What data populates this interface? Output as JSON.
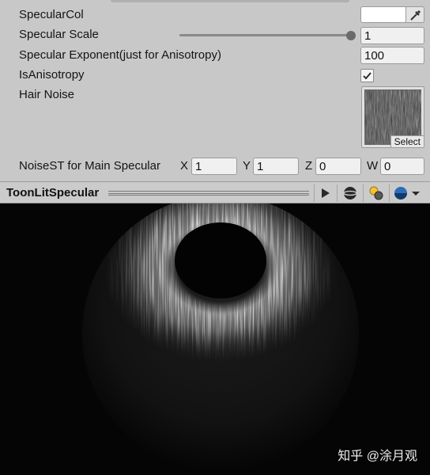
{
  "inspector": {
    "specular_color": {
      "label": "SpecularCol",
      "value_color": "#ffffff",
      "picker_icon": "eyedropper-icon"
    },
    "specular_scale": {
      "label": "Specular Scale",
      "value": "1",
      "slider_fraction": 1.0
    },
    "specular_exponent": {
      "label": "Specular Exponent(just for Anisotropy)",
      "value": "100"
    },
    "is_anisotropy": {
      "label": "IsAnisotropy",
      "checked": true,
      "check_icon": "checkmark-icon"
    },
    "hair_noise": {
      "label": "Hair Noise",
      "select_label": "Select"
    },
    "noise_st": {
      "label": "NoiseST for Main Specular",
      "x_label": "X",
      "x_value": "1",
      "y_label": "Y",
      "y_value": "1",
      "z_label": "Z",
      "z_value": "0",
      "w_label": "W",
      "w_value": "0"
    }
  },
  "preview": {
    "title": "ToonLitSpecular",
    "buttons": [
      "play-icon",
      "sphere-mesh-icon",
      "light-icon",
      "preview-sphere-icon"
    ],
    "background_color": "#050505"
  },
  "watermark": "知乎 @涂月观"
}
